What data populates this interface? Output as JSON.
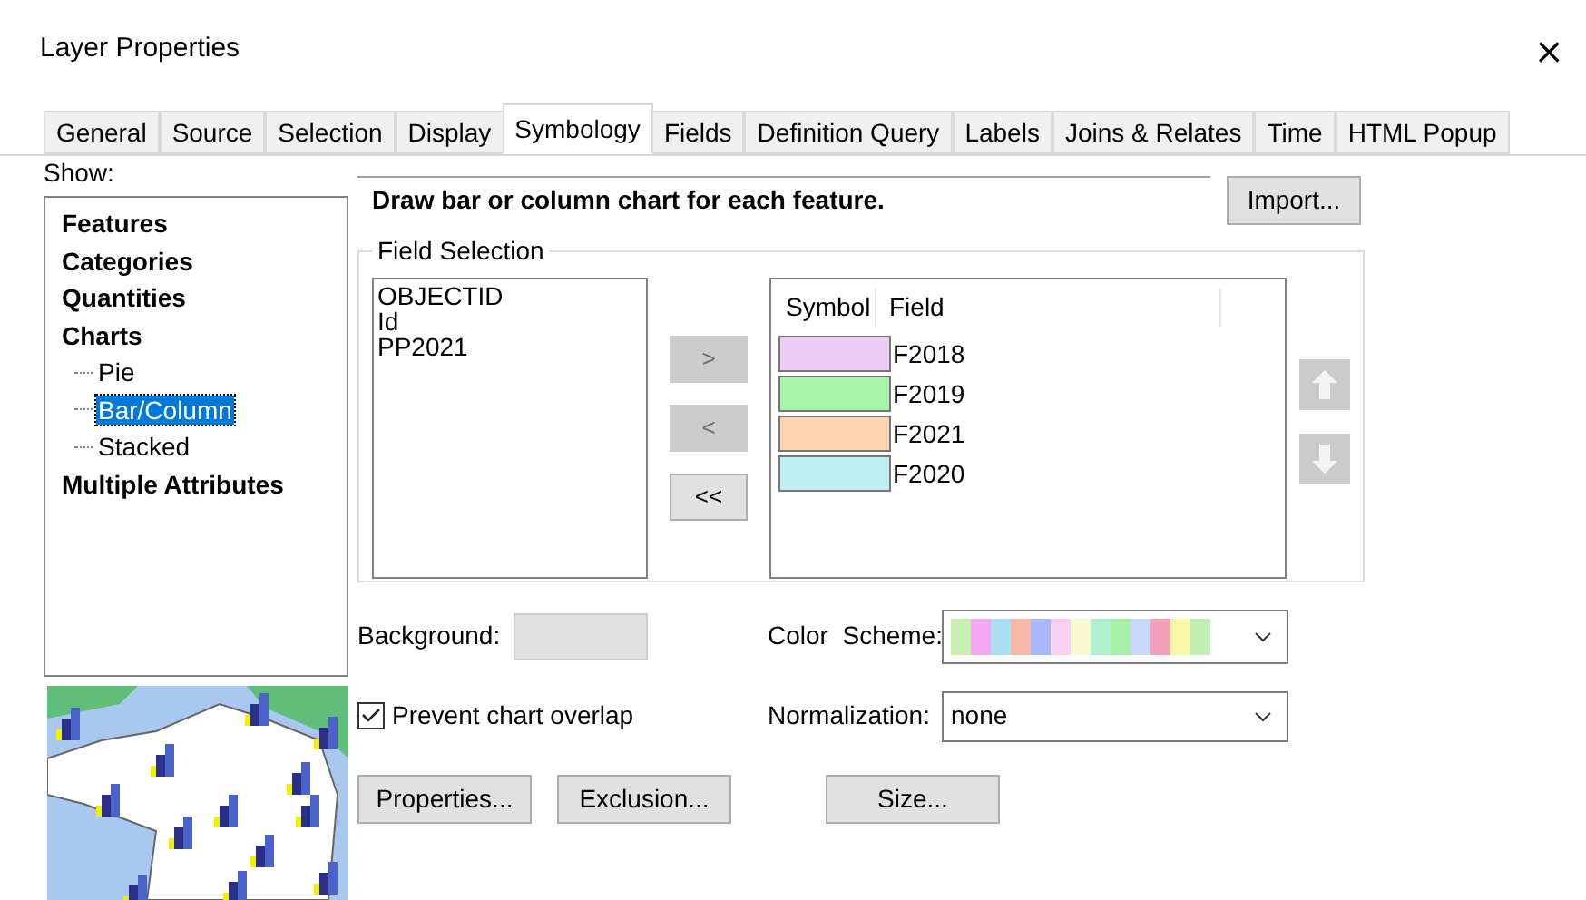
{
  "window": {
    "title": "Layer Properties",
    "close": "×"
  },
  "tabs": [
    {
      "label": "General",
      "selected": false
    },
    {
      "label": "Source",
      "selected": false
    },
    {
      "label": "Selection",
      "selected": false
    },
    {
      "label": "Display",
      "selected": false
    },
    {
      "label": "Symbology",
      "selected": true
    },
    {
      "label": "Fields",
      "selected": false
    },
    {
      "label": "Definition Query",
      "selected": false
    },
    {
      "label": "Labels",
      "selected": false
    },
    {
      "label": "Joins & Relates",
      "selected": false
    },
    {
      "label": "Time",
      "selected": false
    },
    {
      "label": "HTML Popup",
      "selected": false
    }
  ],
  "show": {
    "label": "Show:",
    "items": [
      {
        "label": "Features",
        "selected": false
      },
      {
        "label": "Categories",
        "selected": false
      },
      {
        "label": "Quantities",
        "selected": false
      },
      {
        "label": "Charts",
        "selected": false,
        "children": [
          {
            "label": "Pie",
            "selected": false
          },
          {
            "label": "Bar/Column",
            "selected": true
          },
          {
            "label": "Stacked",
            "selected": false
          }
        ]
      },
      {
        "label": "Multiple Attributes",
        "selected": false
      }
    ]
  },
  "description": "Draw bar or column chart for each feature.",
  "import_button": "Import...",
  "field_selection": {
    "title": "Field Selection",
    "available_fields": [
      "OBJECTID",
      "Id",
      "PP2021"
    ],
    "move_buttons": [
      {
        "label": ">",
        "disabled": true
      },
      {
        "label": "<",
        "disabled": true
      },
      {
        "label": "<<",
        "disabled": false
      }
    ],
    "columns": [
      "Symbol",
      "Field"
    ],
    "selected_fields": [
      {
        "field": "F2018",
        "color": "#eecbf5"
      },
      {
        "field": "F2019",
        "color": "#a8f5a8"
      },
      {
        "field": "F2021",
        "color": "#fdd3b0"
      },
      {
        "field": "F2020",
        "color": "#bfeff5"
      }
    ],
    "order_buttons": [
      {
        "kind": "up",
        "disabled": true
      },
      {
        "kind": "down",
        "disabled": true
      }
    ]
  },
  "background": {
    "label": "Background:"
  },
  "color_scheme": {
    "label": "Color  Scheme:",
    "swatches": [
      {
        "color": "#c8f0b0"
      },
      {
        "color": "#f2a8f2"
      },
      {
        "color": "#a8e0f2"
      },
      {
        "color": "#f8b8a8"
      },
      {
        "color": "#a8b8f8"
      },
      {
        "color": "#f8d0f0"
      },
      {
        "color": "#fafad0"
      },
      {
        "color": "#b0f0d0"
      },
      {
        "color": "#a8f0a8"
      },
      {
        "color": "#c8d8f8"
      },
      {
        "color": "#f4a0b8"
      },
      {
        "color": "#f8f8a8"
      },
      {
        "color": "#c0f0b8"
      }
    ]
  },
  "prevent_overlap": {
    "label": "Prevent chart overlap",
    "checked": true
  },
  "normalization": {
    "label": "Normalization:",
    "value": "none"
  },
  "buttons": [
    "Properties...",
    "Exclusion...",
    "Size..."
  ]
}
